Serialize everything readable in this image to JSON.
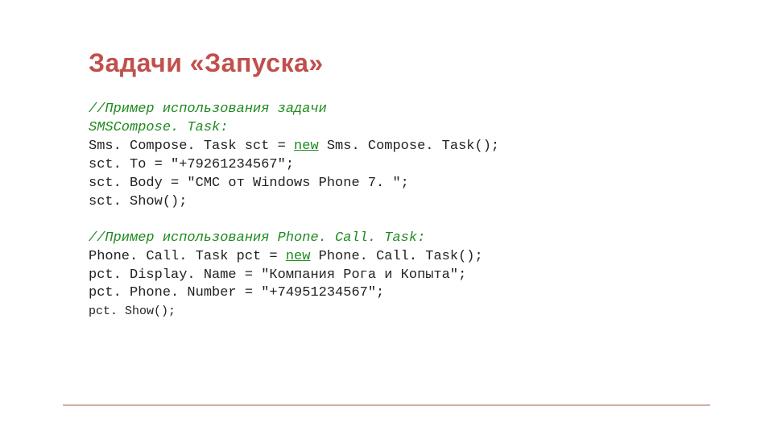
{
  "title": "Задачи «Запуска»",
  "block1": {
    "c1": "//Пример использования задачи",
    "c2": "SMSCompose. Task:",
    "l1a": "Sms. Compose. Task sct = ",
    "l1kw": "new",
    "l1b": " Sms. Compose. Task();",
    "l2": "sct. To = \"+79261234567\";",
    "l3": "sct. Body = \"СМС от Windows Phone 7. \";",
    "l4": "sct. Show();"
  },
  "block2": {
    "c1": "//Пример использования Phone. Call. Task:",
    "l1a": "Phone. Call. Task pct = ",
    "l1kw": "new",
    "l1b": " Phone. Call. Task();",
    "l2": "pct. Display. Name = \"Компания Рога и Копыта\";",
    "l3": "pct. Phone. Number = \"+74951234567\";",
    "l4": "pct. Show();"
  }
}
